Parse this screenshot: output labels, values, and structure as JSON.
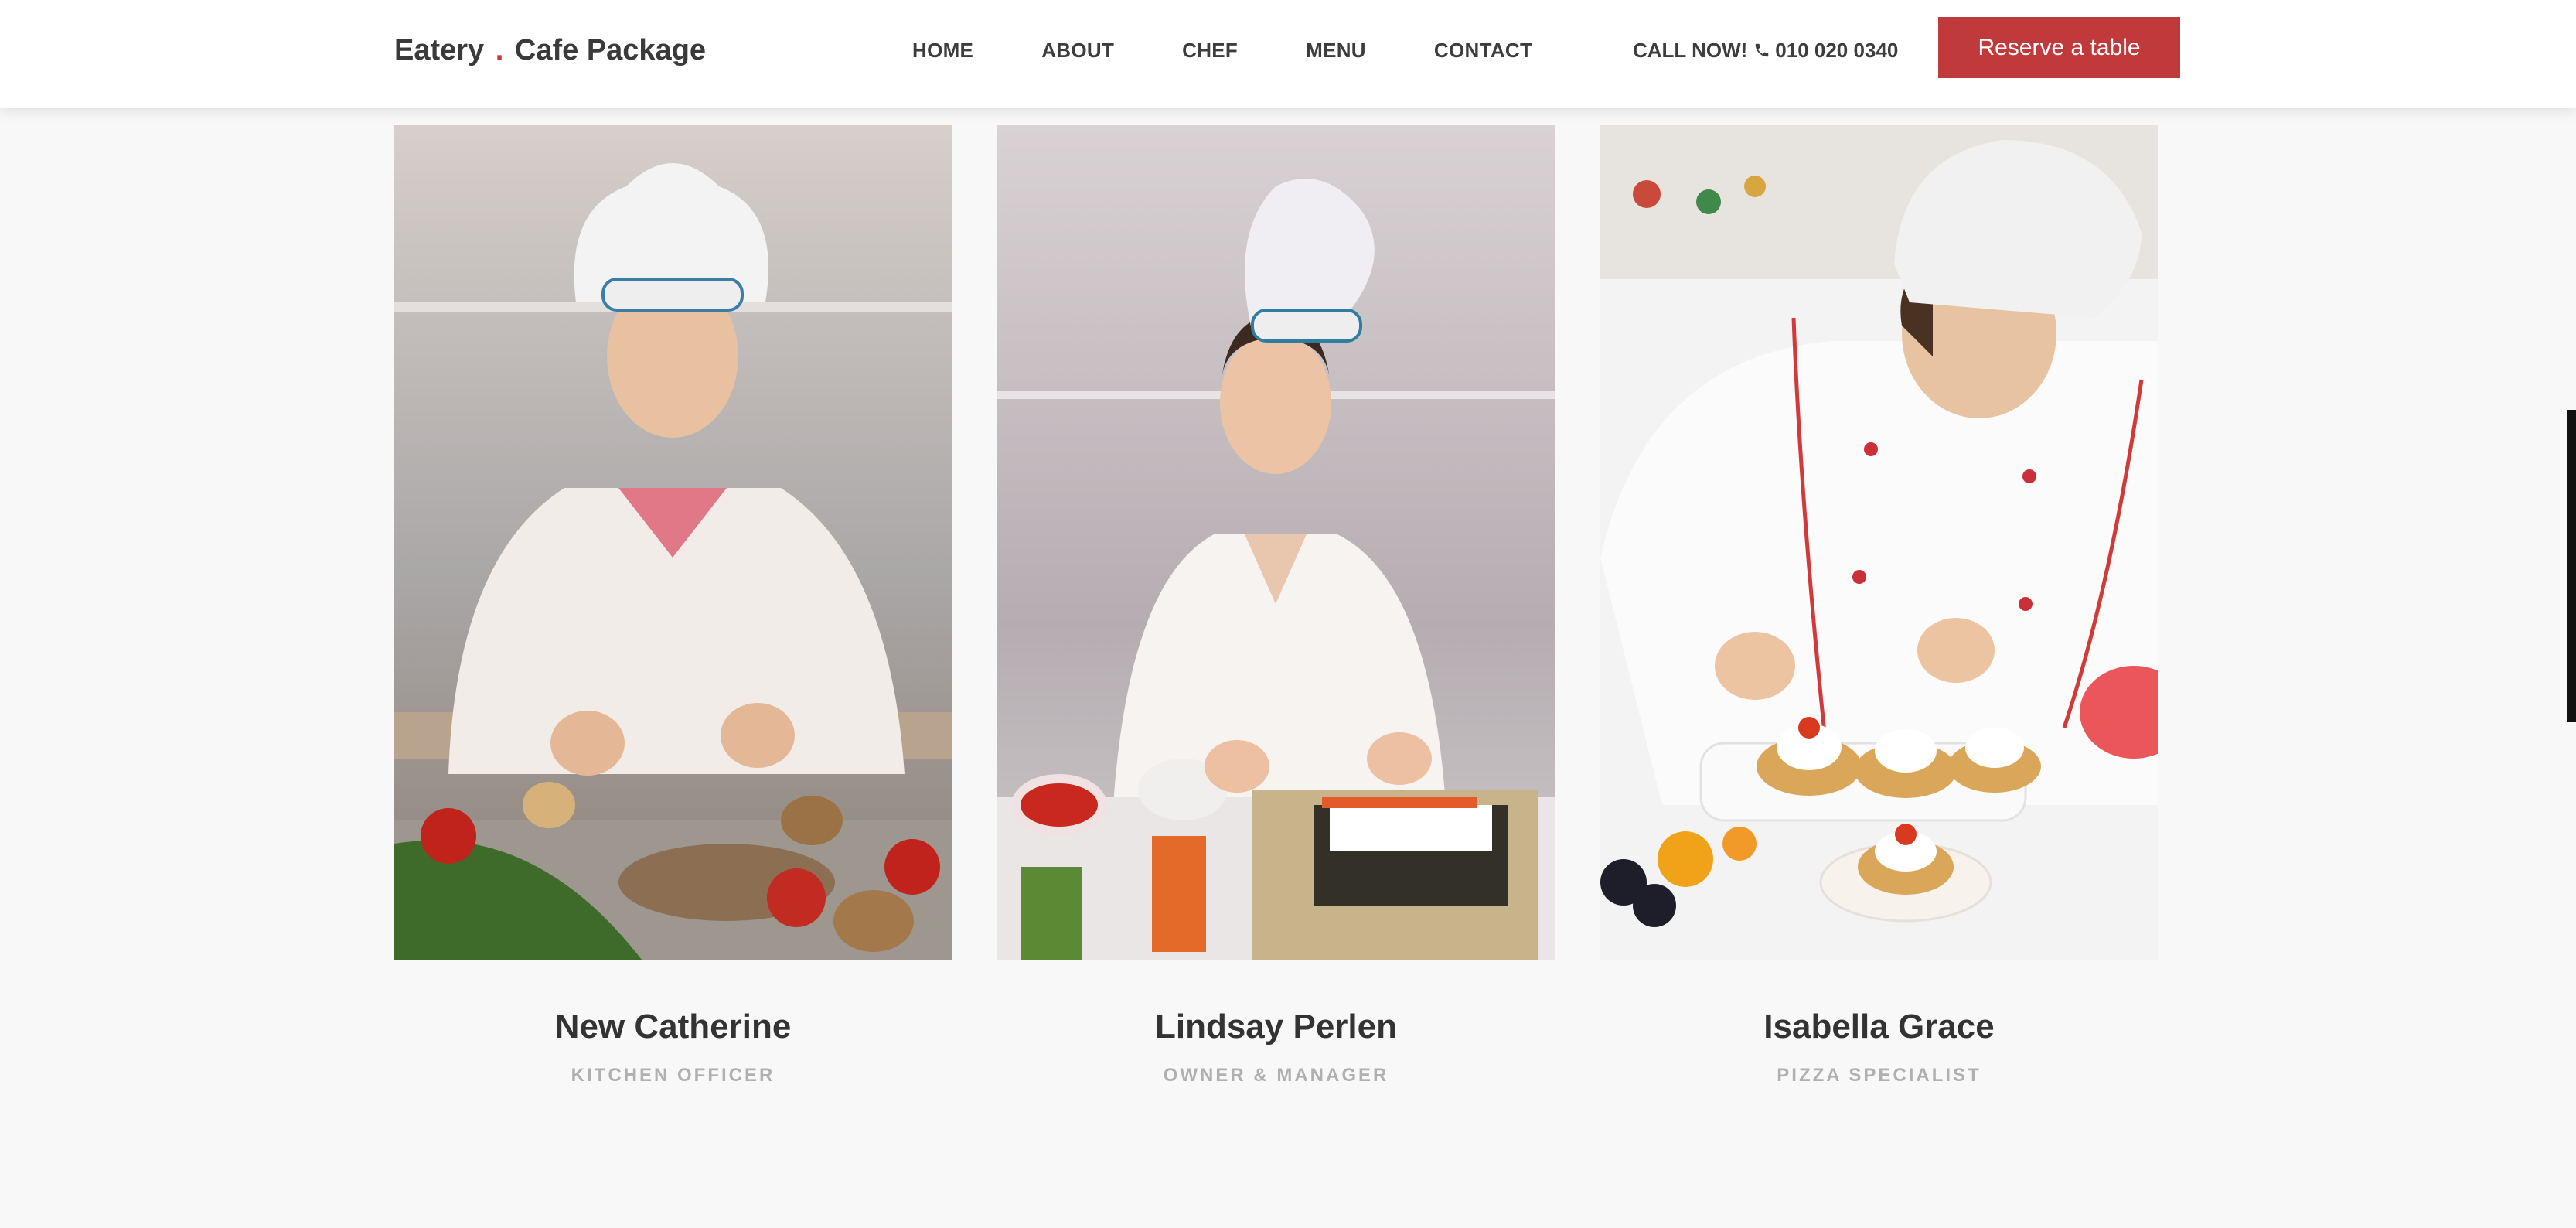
{
  "header": {
    "brand_part1": "Eatery",
    "brand_dot": ".",
    "brand_part2": "Cafe Package",
    "nav": [
      "HOME",
      "ABOUT",
      "CHEF",
      "MENU",
      "CONTACT"
    ],
    "call_label": "CALL NOW!",
    "phone_icon": "phone-icon",
    "phone_number": "010 020 0340",
    "reserve_label": "Reserve a table"
  },
  "chefs": [
    {
      "name": "New Catherine",
      "role": "KITCHEN OFFICER"
    },
    {
      "name": "Lindsay Perlen",
      "role": "OWNER & MANAGER"
    },
    {
      "name": "Isabella Grace",
      "role": "PIZZA SPECIALIST"
    }
  ],
  "colors": {
    "accent": "#c0393b",
    "background": "#f8f8f8",
    "text": "#3a3a3a",
    "muted": "#b0b0b0"
  }
}
